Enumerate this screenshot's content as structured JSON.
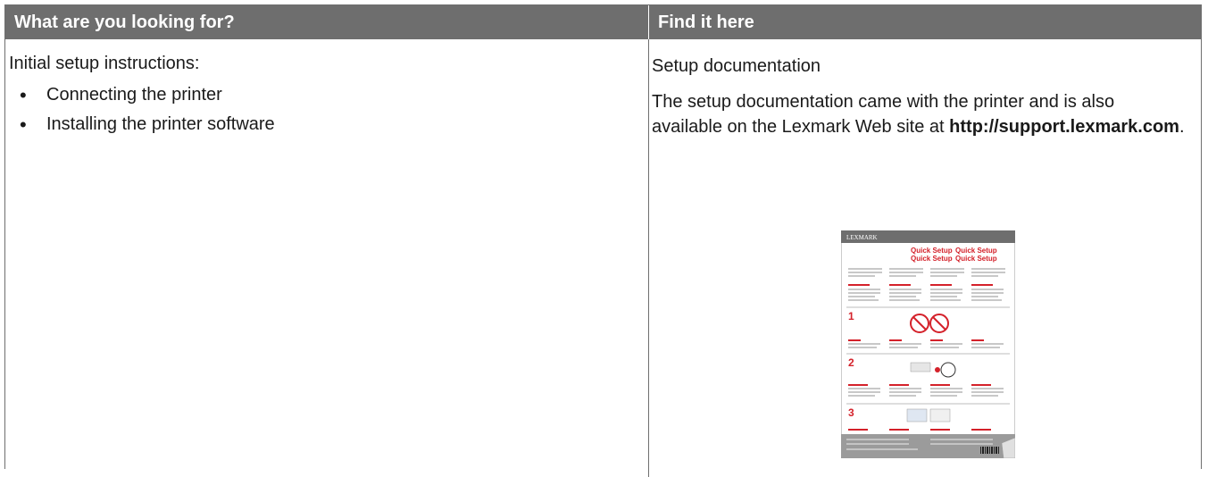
{
  "header": {
    "left": "What are you looking for?",
    "right": "Find it here"
  },
  "left": {
    "intro": "Initial setup instructions:",
    "bullets": [
      "Connecting the printer",
      "Installing the printer software"
    ]
  },
  "right": {
    "title": "Setup documentation",
    "body_before": "The setup documentation came with the printer and is also available on the Lexmark Web site at ",
    "link": "http://support.lexmark.com",
    "body_after": "."
  },
  "thumbnail": {
    "brand": "LEXMARK",
    "headings": [
      "Quick Setup",
      "Quick Setup",
      "Quick Setup",
      "Quick Setup"
    ],
    "steps": [
      "1",
      "2",
      "3"
    ],
    "accent": "#d4212a"
  }
}
